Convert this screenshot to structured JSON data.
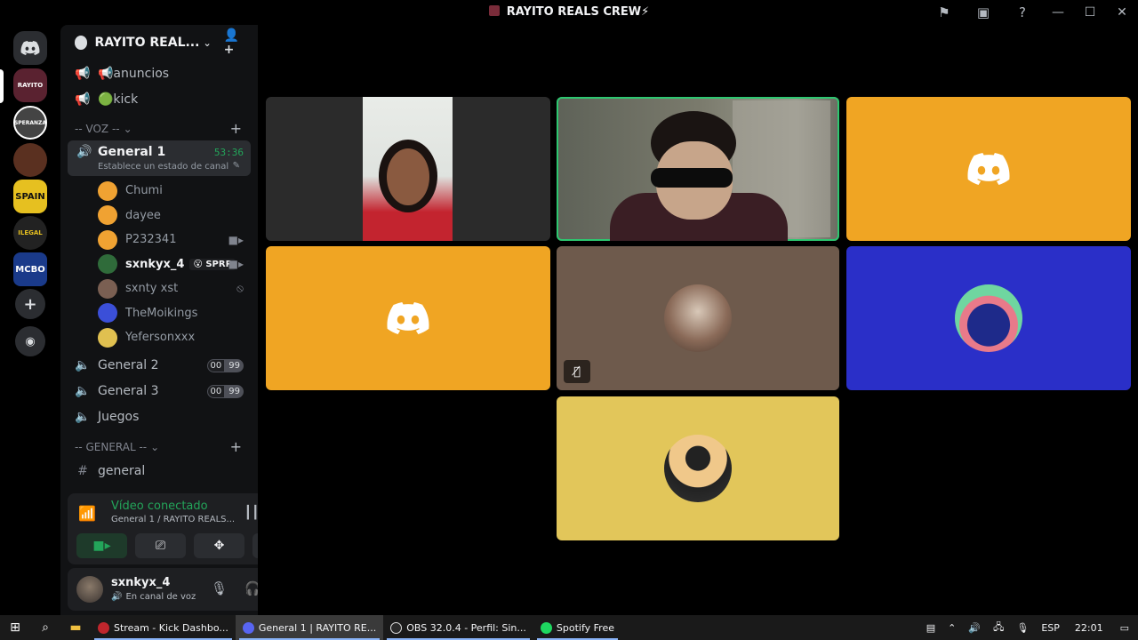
{
  "window": {
    "title": "RAYITO REALS CREW⚡"
  },
  "titlebar_icons": [
    "inbox-flag-icon",
    "inbox-icon",
    "help-icon"
  ],
  "server": {
    "name": "RAYITO REAL..."
  },
  "text_channels_top": [
    {
      "name": "📢anuncios",
      "icon": "megaphone-icon"
    },
    {
      "name": "🟢kick",
      "icon": "megaphone-icon"
    }
  ],
  "voice_category": {
    "label": "-- VOZ --"
  },
  "active_voice": {
    "name": "General 1",
    "timer": "53:36",
    "status_prompt": "Establece un estado de canal"
  },
  "voice_members": [
    {
      "name": "Chumi",
      "color": "#f0a232",
      "right": ""
    },
    {
      "name": "dayee",
      "color": "#f0a232",
      "right": ""
    },
    {
      "name": "P232341",
      "color": "#f0a232",
      "right": "video"
    },
    {
      "name": "sxnkyx_4",
      "color": "#2f6b3a",
      "right": "video",
      "tag": "😮 SPRP",
      "me": true
    },
    {
      "name": "sxnty xst",
      "color": "#7a5f52",
      "right": "muted"
    },
    {
      "name": "TheMoikings",
      "color": "#3b4fd8",
      "right": ""
    },
    {
      "name": "Yefersonxxx",
      "color": "#e0c050",
      "right": ""
    }
  ],
  "other_voice": [
    {
      "name": "General 2",
      "count_a": "00",
      "count_b": "99"
    },
    {
      "name": "General 3",
      "count_a": "00",
      "count_b": "99"
    },
    {
      "name": "Juegos"
    }
  ],
  "general_category": {
    "label": "-- GENERAL --"
  },
  "general_channel": {
    "name": "general"
  },
  "voice_panel": {
    "status": "Vídeo conectado",
    "channel": "General 1 / RAYITO REALS..."
  },
  "user": {
    "name": "sxnkyx_4",
    "status": "En canal de voz"
  },
  "guilds": [
    {
      "label": "",
      "color": "#2b2d31",
      "name": "home"
    },
    {
      "label": "RAYITO",
      "color": "#5a2230",
      "name": "rayito-reals"
    },
    {
      "label": "SPERANZA",
      "color": "#444",
      "name": "speranza"
    },
    {
      "label": "",
      "color": "#5a3020",
      "name": "server-3"
    },
    {
      "label": "SPAIN",
      "color": "#e6c020",
      "name": "spain"
    },
    {
      "label": "ILEGAL",
      "color": "#222",
      "name": "ilegal-spainrp"
    },
    {
      "label": "MCBO",
      "color": "#1a3a8a",
      "name": "mcbo"
    }
  ],
  "tiles": [
    {
      "kind": "camera",
      "name": "dayee-camera",
      "bg": "#2b2b2b"
    },
    {
      "kind": "camera",
      "name": "sxnkyx-camera",
      "bg": "#6b6b60",
      "speaking": true
    },
    {
      "kind": "logo",
      "name": "chumi-tile",
      "bg": "#f0a523"
    },
    {
      "kind": "logo",
      "name": "p232341-tile",
      "bg": "#f0a523"
    },
    {
      "kind": "avatar",
      "name": "sxnty-tile",
      "bg": "#6e5a4c",
      "muted": true
    },
    {
      "kind": "avatar",
      "name": "themoikings-tile",
      "bg": "#2a2fc8"
    },
    {
      "kind": "avatar",
      "name": "yefersonxxx-tile",
      "bg": "#e2c65a"
    }
  ],
  "taskbar": {
    "tasks": [
      {
        "label": "Stream - Kick Dashbo...",
        "color": "#c0262d"
      },
      {
        "label": "General 1 | RAYITO RE...",
        "color": "#5865f2",
        "active": true
      },
      {
        "label": "OBS 32.0.4 - Perfil: Sin...",
        "color": "#2a2a2a"
      },
      {
        "label": "Spotify Free",
        "color": "#1ed760"
      }
    ],
    "lang": "ESP",
    "time": "22:01"
  }
}
